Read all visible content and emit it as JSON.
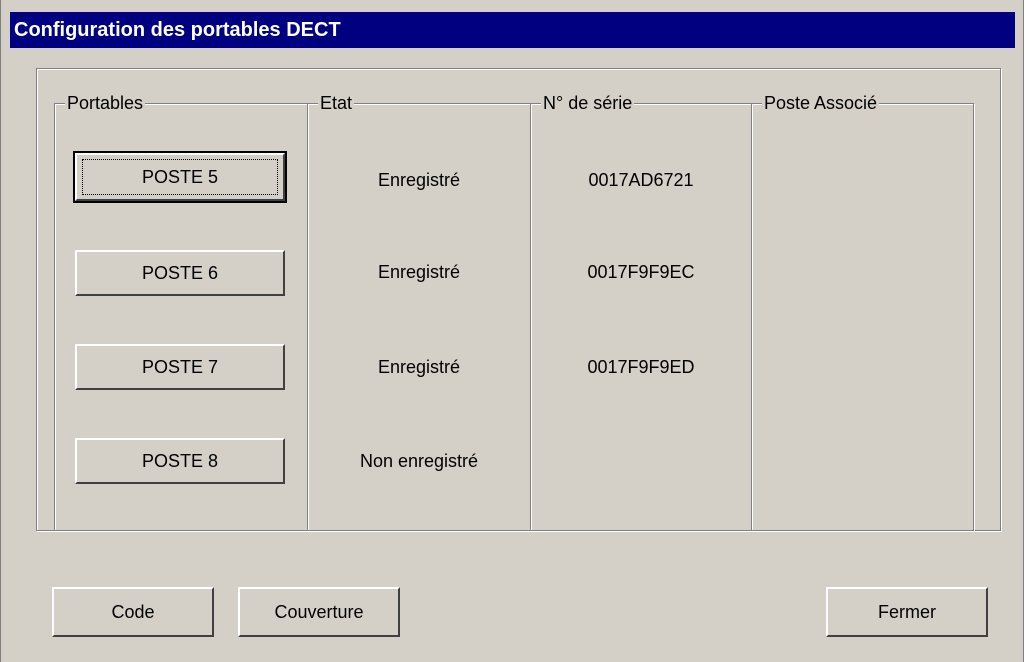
{
  "window": {
    "title": "Configuration des portables DECT"
  },
  "columns": {
    "portables": "Portables",
    "etat": "Etat",
    "serie": "N° de série",
    "poste_associe": "Poste Associé"
  },
  "rows": [
    {
      "button": "POSTE 5",
      "etat": "Enregistré",
      "serie": "0017AD6721",
      "poste": ""
    },
    {
      "button": "POSTE 6",
      "etat": "Enregistré",
      "serie": "0017F9F9EC",
      "poste": ""
    },
    {
      "button": "POSTE 7",
      "etat": "Enregistré",
      "serie": "0017F9F9ED",
      "poste": ""
    },
    {
      "button": "POSTE 8",
      "etat": "Non enregistré",
      "serie": "",
      "poste": ""
    }
  ],
  "footer": {
    "code": "Code",
    "couverture": "Couverture",
    "fermer": "Fermer"
  }
}
